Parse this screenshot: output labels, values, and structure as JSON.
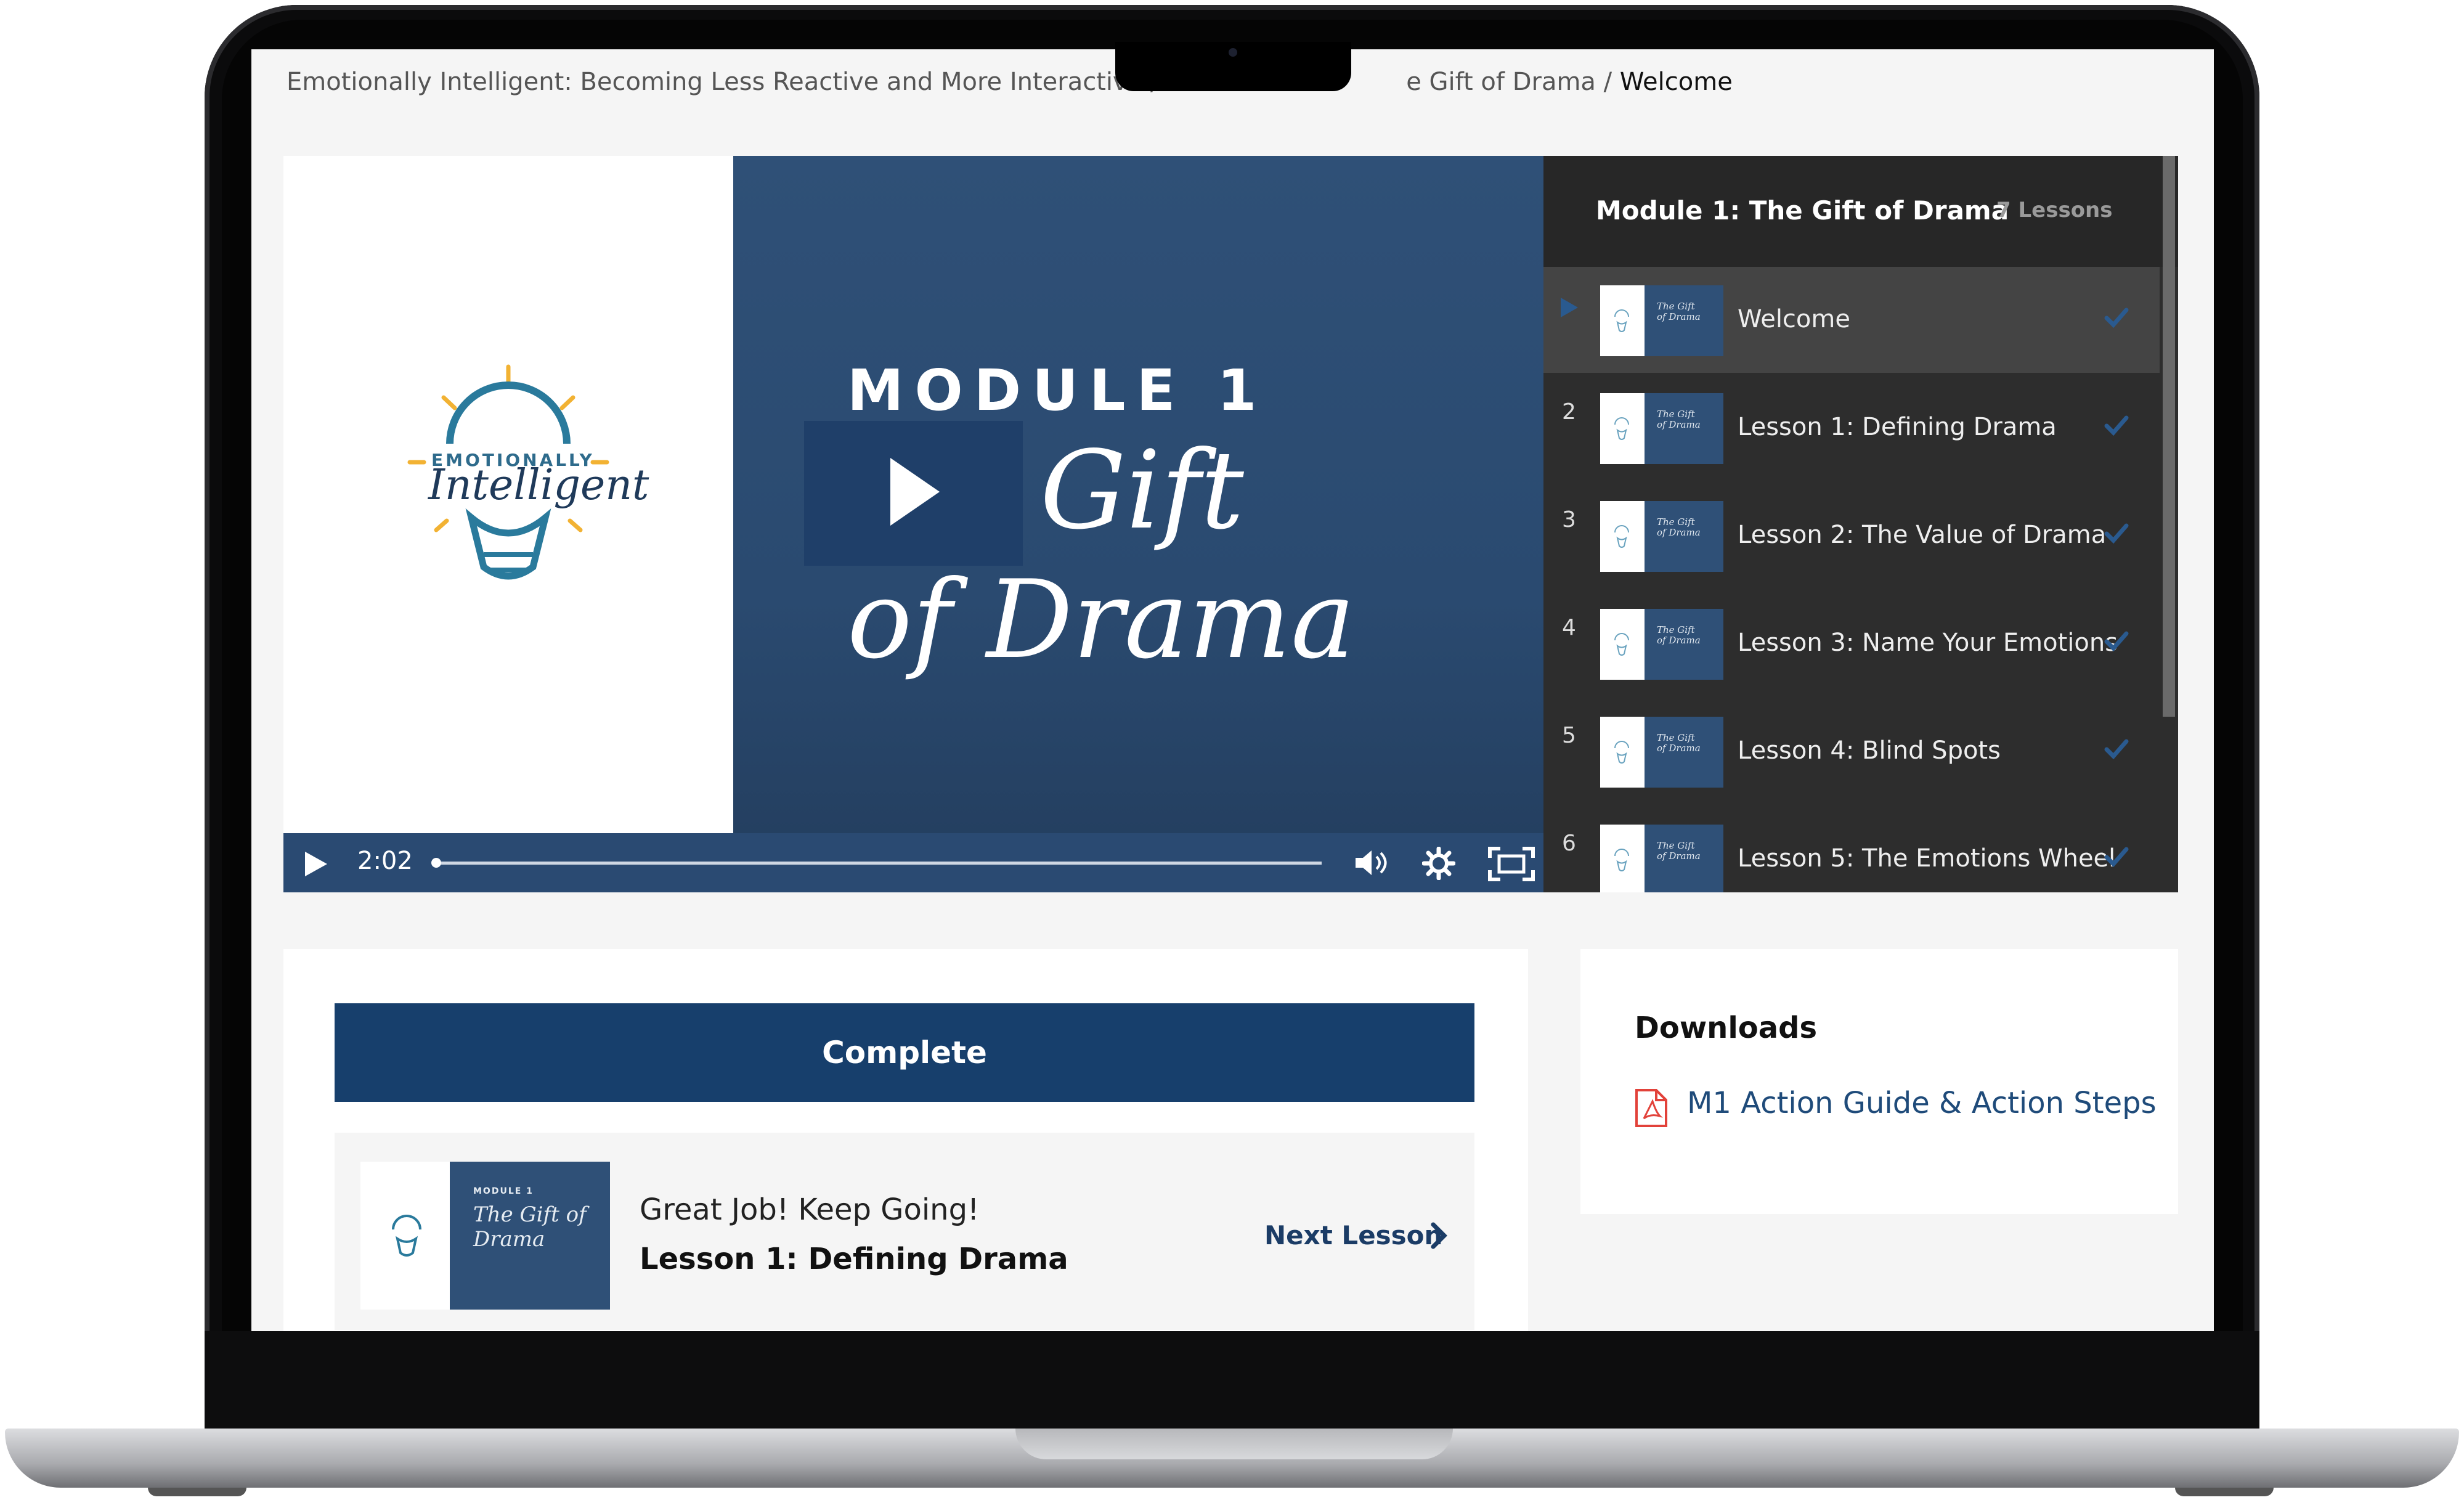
{
  "breadcrumb": {
    "part1": "Emotionally Intelligent: Becoming Less Reactive and More Interactive / Mo",
    "part2": "e Gift of Drama / ",
    "current": "Welcome"
  },
  "video": {
    "logo_word1": "EMOTIONALLY",
    "logo_word2": "Intelligent",
    "module_label": "MODULE 1",
    "title_line1": "Gift",
    "title_line2": "of Drama",
    "time": "2:02",
    "progress": 0.0,
    "icons": [
      "play-icon",
      "volume-icon",
      "settings-icon",
      "fullscreen-icon"
    ]
  },
  "playlist": {
    "title": "Module 1: The Gift of Drama",
    "count": "7 Lessons",
    "thumb_text": "The Gift of Drama",
    "items": [
      {
        "num": "",
        "label": "Welcome",
        "active": true,
        "done": true
      },
      {
        "num": "2",
        "label": "Lesson 1: Defining Drama",
        "active": false,
        "done": true
      },
      {
        "num": "3",
        "label": "Lesson 2: The Value of Drama",
        "active": false,
        "done": true
      },
      {
        "num": "4",
        "label": "Lesson 3: Name Your Emotions",
        "active": false,
        "done": true
      },
      {
        "num": "5",
        "label": "Lesson 4: Blind Spots",
        "active": false,
        "done": true
      },
      {
        "num": "6",
        "label": "Lesson 5: The Emotions Wheel",
        "active": false,
        "done": true
      }
    ]
  },
  "lesson_actions": {
    "complete_label": "Complete",
    "next_thumb_mark": "MODULE 1",
    "next_thumb_title": "The Gift of Drama",
    "encouragement": "Great Job! Keep Going!",
    "next_title": "Lesson 1: Defining Drama",
    "next_label": "Next Lesson"
  },
  "downloads": {
    "title": "Downloads",
    "file_label": "M1 Action Guide & Action Steps"
  },
  "colors": {
    "accent": "#173f6c",
    "video_bg": "#2f5077",
    "playlist_bg": "#2d2d2d",
    "check": "#2a5a8f"
  }
}
